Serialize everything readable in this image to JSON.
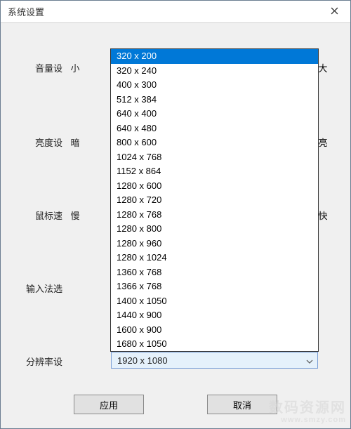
{
  "window": {
    "title": "系统设置"
  },
  "labels": {
    "volume": "音量设",
    "volume_min": "小",
    "volume_max": "大",
    "brightness": "亮度设",
    "brightness_min": "暗",
    "brightness_max": "亮",
    "mouse": "鼠标速",
    "mouse_min": "慢",
    "mouse_max": "快",
    "ime": "输入法选",
    "resolution": "分辨率设"
  },
  "resolution": {
    "selected": "1920 x 1080",
    "highlighted": "320 x 200",
    "options": [
      "320 x 200",
      "320 x 240",
      "400 x 300",
      "512 x 384",
      "640 x 400",
      "640 x 480",
      "800 x 600",
      "1024 x 768",
      "1152 x 864",
      "1280 x 600",
      "1280 x 720",
      "1280 x 768",
      "1280 x 800",
      "1280 x 960",
      "1280 x 1024",
      "1360 x 768",
      "1366 x 768",
      "1400 x 1050",
      "1440 x 900",
      "1600 x 900",
      "1680 x 1050",
      "1920 x 1080"
    ]
  },
  "buttons": {
    "apply": "应用",
    "cancel": "取消"
  },
  "watermark": {
    "main": "数码资源网",
    "sub": "www.smzy.com"
  }
}
